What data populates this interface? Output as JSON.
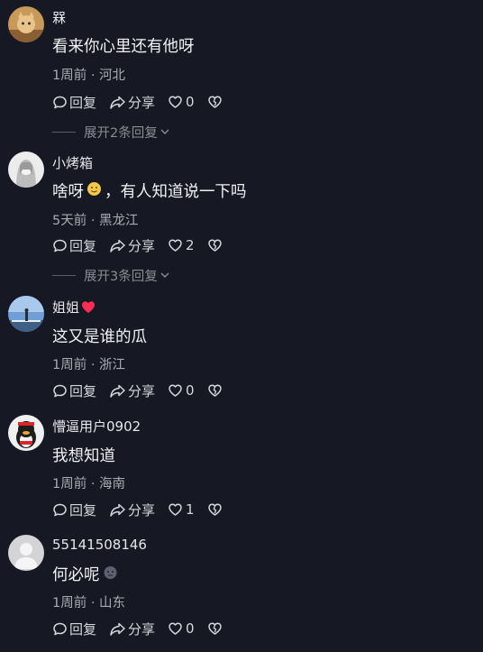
{
  "comments": [
    {
      "username": "槑",
      "text": "看来你心里还有他呀",
      "meta": "1周前 · 河北",
      "reply_label": "回复",
      "share_label": "分享",
      "likes": "0",
      "expand_label": "展开2条回复"
    },
    {
      "username": "小烤箱",
      "text_before": "啥呀",
      "text_after": "，有人知道说一下吗",
      "meta": "5天前 · 黑龙江",
      "reply_label": "回复",
      "share_label": "分享",
      "likes": "2",
      "expand_label": "展开3条回复"
    },
    {
      "username": "姐姐",
      "text": "这又是谁的瓜",
      "meta": "1周前 · 浙江",
      "reply_label": "回复",
      "share_label": "分享",
      "likes": "0"
    },
    {
      "username": "懵逼用户0902",
      "text": "我想知道",
      "meta": "1周前 · 海南",
      "reply_label": "回复",
      "share_label": "分享",
      "likes": "1"
    },
    {
      "username": "55141508146",
      "text": "何必呢",
      "meta": "1周前 · 山东",
      "reply_label": "回复",
      "share_label": "分享",
      "likes": "0"
    }
  ],
  "colors": {
    "background": "#161823",
    "heart_badge": "#fe2c55"
  },
  "icons": [
    "reply-icon",
    "share-icon",
    "like-icon",
    "dislike-icon",
    "chevron-down-icon",
    "heart-badge-icon",
    "emoji-icon"
  ]
}
